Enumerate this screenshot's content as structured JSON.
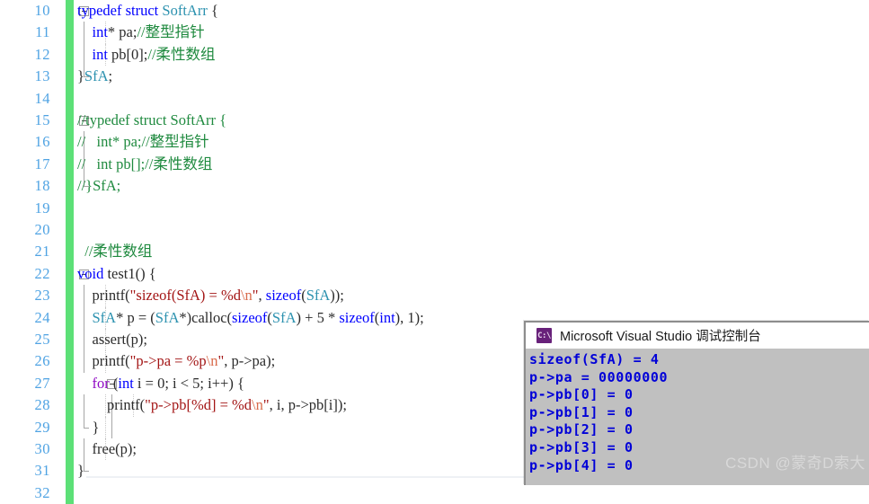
{
  "editor": {
    "language": "c",
    "first_visible_line": 10,
    "last_visible_line": 32,
    "gutter": {
      "change_bar_color": "#5ce077",
      "line_number_color": "#4fa3e3"
    },
    "syntax_colors": {
      "keyword": "#0000ff",
      "control": "#8f08c4",
      "type": "#2b91af",
      "comment": "#1f8a3f",
      "string": "#a31515",
      "escape": "#d96a4a",
      "plain": "#2b2b2b"
    },
    "lines": [
      {
        "n": 10,
        "fold": "open",
        "guides": [],
        "text": "typedef struct SoftArr {"
      },
      {
        "n": 11,
        "fold": "bar",
        "guides": [
          117
        ],
        "text": "    int* pa;//整型指针"
      },
      {
        "n": 12,
        "fold": "bar",
        "guides": [
          117
        ],
        "text": "    int pb[0];//柔性数组"
      },
      {
        "n": 13,
        "fold": "close",
        "guides": [],
        "text": "}SfA;"
      },
      {
        "n": 14,
        "fold": "none",
        "guides": [],
        "text": ""
      },
      {
        "n": 15,
        "fold": "open",
        "guides": [],
        "text": "//typedef struct SoftArr {"
      },
      {
        "n": 16,
        "fold": "bar",
        "guides": [],
        "text": "//   int* pa;//整型指针"
      },
      {
        "n": 17,
        "fold": "bar",
        "guides": [],
        "text": "//   int pb[];//柔性数组"
      },
      {
        "n": 18,
        "fold": "close",
        "guides": [],
        "text": "//}SfA;"
      },
      {
        "n": 19,
        "fold": "none",
        "guides": [],
        "text": ""
      },
      {
        "n": 20,
        "fold": "none",
        "guides": [],
        "text": ""
      },
      {
        "n": 21,
        "fold": "none",
        "guides": [],
        "text": "  //柔性数组"
      },
      {
        "n": 22,
        "fold": "open",
        "guides": [],
        "text": "void test1() {"
      },
      {
        "n": 23,
        "fold": "bar",
        "guides": [
          117
        ],
        "text": "    printf(\"sizeof(SfA) = %d\\n\", sizeof(SfA));"
      },
      {
        "n": 24,
        "fold": "bar",
        "guides": [
          117
        ],
        "text": "    SfA* p = (SfA*)calloc(sizeof(SfA) + 5 * sizeof(int), 1);"
      },
      {
        "n": 25,
        "fold": "bar",
        "guides": [
          117
        ],
        "text": "    assert(p);"
      },
      {
        "n": 26,
        "fold": "bar",
        "guides": [
          117
        ],
        "text": "    printf(\"p->pa = %p\\n\", p->pa);"
      },
      {
        "n": 27,
        "fold": "open2",
        "guides": [],
        "text": "    for (int i = 0; i < 5; i++) {"
      },
      {
        "n": 28,
        "fold": "bar",
        "guides": [
          117,
          148
        ],
        "text": "        printf(\"p->pb[%d] = %d\\n\", i, p->pb[i]);"
      },
      {
        "n": 29,
        "fold": "close2",
        "guides": [
          117
        ],
        "text": "    }"
      },
      {
        "n": 30,
        "fold": "bar",
        "guides": [
          117
        ],
        "text": "    free(p);"
      },
      {
        "n": 31,
        "fold": "close",
        "guides": [],
        "text": "}"
      },
      {
        "n": 32,
        "fold": "none",
        "guides": [],
        "text": ""
      }
    ]
  },
  "console": {
    "icon": "console-app-icon",
    "icon_glyph": "C:\\",
    "title": "Microsoft Visual Studio 调试控制台",
    "text_color": "#0000d8",
    "background_color": "#c0c0c0",
    "output_lines": [
      "sizeof(SfA) = 4",
      "p->pa = 00000000",
      "p->pb[0] = 0",
      "p->pb[1] = 0",
      "p->pb[2] = 0",
      "p->pb[3] = 0",
      "p->pb[4] = 0"
    ]
  },
  "watermark": {
    "text": "CSDN @蒙奇D索大"
  }
}
